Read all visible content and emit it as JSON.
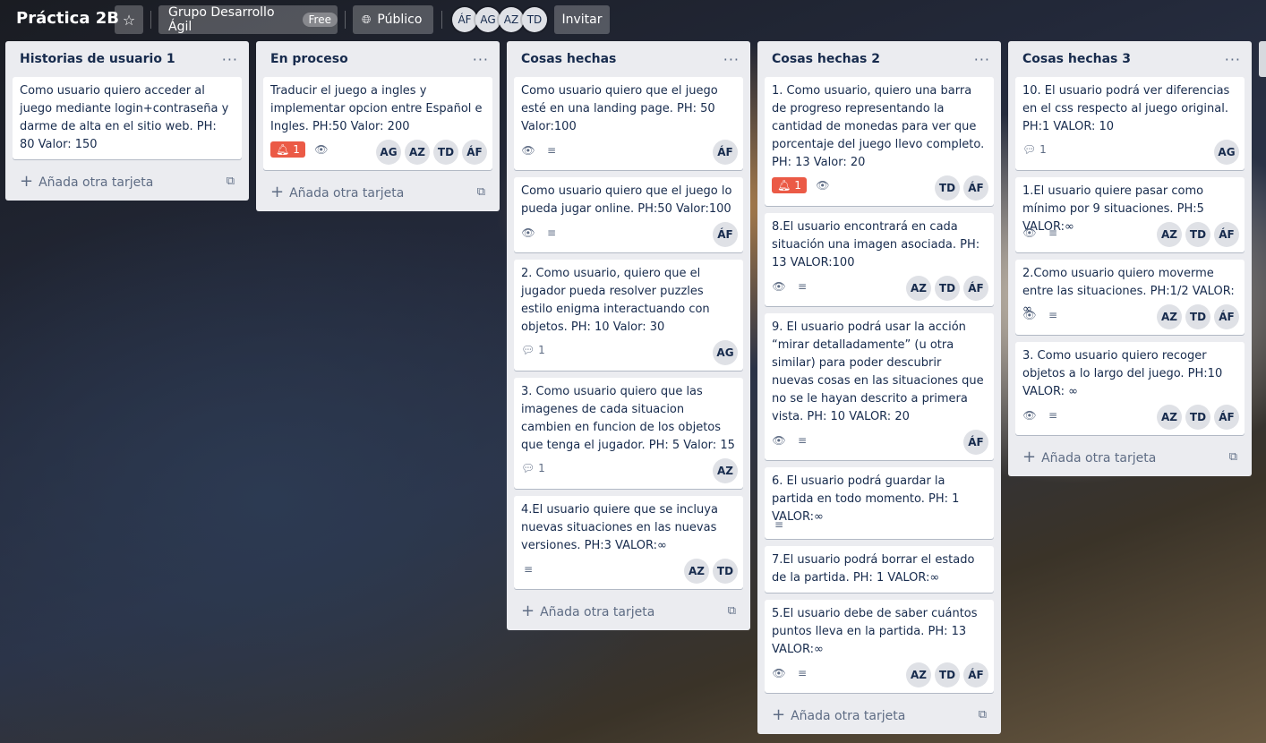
{
  "header": {
    "board_title": "Práctica 2B",
    "team_name": "Grupo Desarrollo Ágil",
    "plan_badge": "Free",
    "visibility": "Público",
    "members": [
      "ÁF",
      "AG",
      "AZ",
      "TD"
    ],
    "invite_label": "Invitar"
  },
  "add_card_label": "Añada otra tarjeta",
  "lists": [
    {
      "title": "Historias de usuario 1",
      "cards": [
        {
          "text": "Como usuario quiero acceder al juego mediante login+contraseña y darme de alta en el sitio web. PH: 80 Valor: 150"
        }
      ]
    },
    {
      "title": "En proceso",
      "cards": [
        {
          "text": "Traducir el juego a ingles y implementar opcion entre Español e Ingles. PH:50 Valor: 200",
          "alert": "1",
          "members": [
            "AG",
            "AZ",
            "TD",
            "ÁF"
          ]
        }
      ]
    },
    {
      "title": "Cosas hechas",
      "cards": [
        {
          "text": "Como usuario quiero que el juego esté en una landing page. PH: 50 Valor:100",
          "members": [
            "ÁF"
          ]
        },
        {
          "text": "Como usuario quiero que el juego lo pueda jugar online. PH:50 Valor:100",
          "members": [
            "ÁF"
          ]
        },
        {
          "text": "2. Como usuario, quiero que el jugador pueda resolver puzzles estilo enigma interactuando con objetos. PH: 10 Valor: 30",
          "comments": "1",
          "members": [
            "AG"
          ]
        },
        {
          "text": "3. Como usuario quiero que las imagenes de cada situacion cambien en funcion de los objetos que tenga el jugador. PH: 5 Valor: 15",
          "comments": "1",
          "members": [
            "AZ"
          ]
        },
        {
          "text": "4.El usuario quiere que se incluya nuevas situaciones en las nuevas versiones. PH:3 VALOR:∞",
          "members": [
            "AZ",
            "TD"
          ]
        }
      ]
    },
    {
      "title": "Cosas hechas 2",
      "cards": [
        {
          "text": "1. Como usuario, quiero una barra de progreso representando la cantidad de monedas para ver que porcentaje del juego llevo completo. PH: 13 Valor: 20",
          "alert": "1",
          "members": [
            "TD",
            "ÁF"
          ]
        },
        {
          "text": "8.El usuario encontrará en cada situación una imagen asociada. PH: 13 VALOR:100",
          "members": [
            "AZ",
            "TD",
            "ÁF"
          ]
        },
        {
          "text": "9. El usuario podrá usar la acción “mirar detalladamente” (u otra similar) para poder descubrir nuevas cosas en las situaciones que no se le hayan descrito a primera vista. PH: 10 VALOR: 20",
          "members": [
            "ÁF"
          ]
        },
        {
          "text": "6. El usuario podrá guardar la partida en todo momento. PH: 1 VALOR:∞"
        },
        {
          "text": "7.El usuario podrá borrar el estado de la partida. PH: 1 VALOR:∞"
        },
        {
          "text": "5.El usuario debe de saber cuántos puntos lleva en la partida. PH: 13 VALOR:∞",
          "members": [
            "AZ",
            "TD",
            "ÁF"
          ]
        }
      ]
    },
    {
      "title": "Cosas hechas 3",
      "cards": [
        {
          "text": "10. El usuario podrá ver diferencias en el css respecto al juego original. PH:1 VALOR: 10",
          "comments": "1",
          "members": [
            "AG"
          ]
        },
        {
          "text": "1.El usuario quiere pasar como mínimo por 9 situaciones. PH:5 VALOR:∞",
          "members": [
            "AZ",
            "TD",
            "ÁF"
          ]
        },
        {
          "text": "2.Como usuario quiero moverme entre las situaciones. PH:1/2 VALOR: ∞",
          "members": [
            "AZ",
            "TD",
            "ÁF"
          ]
        },
        {
          "text": "3. Como usuario quiero recoger objetos a lo largo del juego. PH:10 VALOR: ∞",
          "members": [
            "AZ",
            "TD",
            "ÁF"
          ]
        }
      ]
    }
  ]
}
